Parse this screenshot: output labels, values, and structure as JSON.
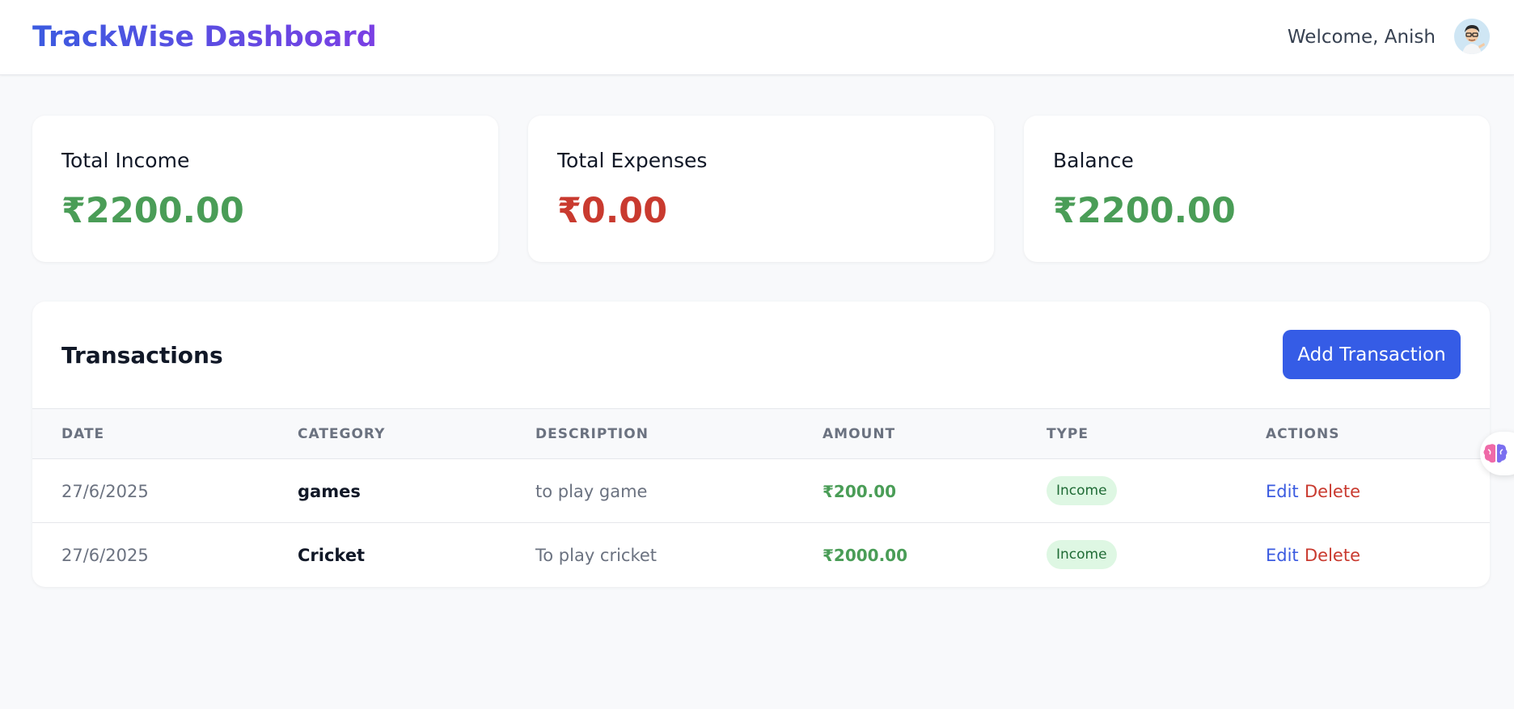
{
  "header": {
    "title": "TrackWise Dashboard",
    "welcome": "Welcome, Anish"
  },
  "summary": [
    {
      "label": "Total Income",
      "value": "₹2200.00"
    },
    {
      "label": "Total Expenses",
      "value": "₹0.00"
    },
    {
      "label": "Balance",
      "value": "₹2200.00"
    }
  ],
  "transactions": {
    "title": "Transactions",
    "add_button": "Add Transaction",
    "columns": [
      "DATE",
      "CATEGORY",
      "DESCRIPTION",
      "AMOUNT",
      "TYPE",
      "ACTIONS"
    ],
    "rows": [
      {
        "date": "27/6/2025",
        "category": "games",
        "description": "to play game",
        "amount": "₹200.00",
        "type": "Income",
        "edit": "Edit",
        "delete": "Delete"
      },
      {
        "date": "27/6/2025",
        "category": "Cricket",
        "description": "To play cricket",
        "amount": "₹2000.00",
        "type": "Income",
        "edit": "Edit",
        "delete": "Delete"
      }
    ]
  },
  "colors": {
    "primary": "#355ce6",
    "income": "#4a9d57",
    "expense": "#c93a2f",
    "brand_gradient_start": "#3b5be0",
    "brand_gradient_end": "#7b3fe4"
  },
  "icons": {
    "avatar": "user-avatar",
    "floating_widget": "brain-icon"
  }
}
